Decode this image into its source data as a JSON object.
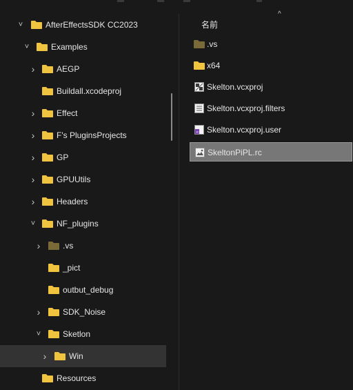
{
  "tree": {
    "items": [
      {
        "label": "AfterEffectsSDK CC2023",
        "expand": "expanded",
        "icon": "folder-icon",
        "dim": false,
        "selected": false
      },
      {
        "label": "Examples",
        "expand": "expanded",
        "icon": "folder-icon",
        "dim": false,
        "selected": false
      },
      {
        "label": "AEGP",
        "expand": "collapsed",
        "icon": "folder-icon",
        "dim": false,
        "selected": false
      },
      {
        "label": "Buildall.xcodeproj",
        "expand": "none",
        "icon": "folder-icon",
        "dim": false,
        "selected": false
      },
      {
        "label": "Effect",
        "expand": "collapsed",
        "icon": "folder-icon",
        "dim": false,
        "selected": false
      },
      {
        "label": "F's PluginsProjects",
        "expand": "collapsed",
        "icon": "folder-icon",
        "dim": false,
        "selected": false
      },
      {
        "label": "GP",
        "expand": "collapsed",
        "icon": "folder-icon",
        "dim": false,
        "selected": false
      },
      {
        "label": "GPUUtils",
        "expand": "collapsed",
        "icon": "folder-icon",
        "dim": false,
        "selected": false
      },
      {
        "label": "Headers",
        "expand": "collapsed",
        "icon": "folder-icon",
        "dim": false,
        "selected": false
      },
      {
        "label": "NF_plugins",
        "expand": "expanded",
        "icon": "folder-icon",
        "dim": false,
        "selected": false
      },
      {
        "label": ".vs",
        "expand": "collapsed",
        "icon": "folder-icon",
        "dim": true,
        "selected": false
      },
      {
        "label": "_pict",
        "expand": "none",
        "icon": "folder-icon",
        "dim": false,
        "selected": false
      },
      {
        "label": "outbut_debug",
        "expand": "none",
        "icon": "folder-icon",
        "dim": false,
        "selected": false
      },
      {
        "label": "SDK_Noise",
        "expand": "collapsed",
        "icon": "folder-icon",
        "dim": false,
        "selected": false
      },
      {
        "label": "Sketlon",
        "expand": "expanded",
        "icon": "folder-icon",
        "dim": false,
        "selected": false
      },
      {
        "label": "Win",
        "expand": "collapsed",
        "icon": "folder-icon",
        "dim": false,
        "selected": true
      },
      {
        "label": "Resources",
        "expand": "none",
        "icon": "folder-icon",
        "dim": false,
        "selected": false
      }
    ]
  },
  "content": {
    "column_header": "名前",
    "files": [
      {
        "name": ".vs",
        "icon": "folder-icon",
        "dim": true,
        "selected": false
      },
      {
        "name": "x64",
        "icon": "folder-icon",
        "dim": false,
        "selected": false
      },
      {
        "name": "Skelton.vcxproj",
        "icon": "vcxproj-file-icon",
        "dim": false,
        "selected": false
      },
      {
        "name": "Skelton.vcxproj.filters",
        "icon": "filters-file-icon",
        "dim": false,
        "selected": false
      },
      {
        "name": "Skelton.vcxproj.user",
        "icon": "user-file-icon",
        "dim": false,
        "selected": false
      },
      {
        "name": "SkeltonPiPL.rc",
        "icon": "rc-file-icon",
        "dim": false,
        "selected": true
      }
    ]
  },
  "colors": {
    "folder": "#f0c440",
    "folder_dim": "#7a6a38",
    "background": "#191919",
    "selected_tree": "#333333",
    "selected_file": "#777777"
  }
}
